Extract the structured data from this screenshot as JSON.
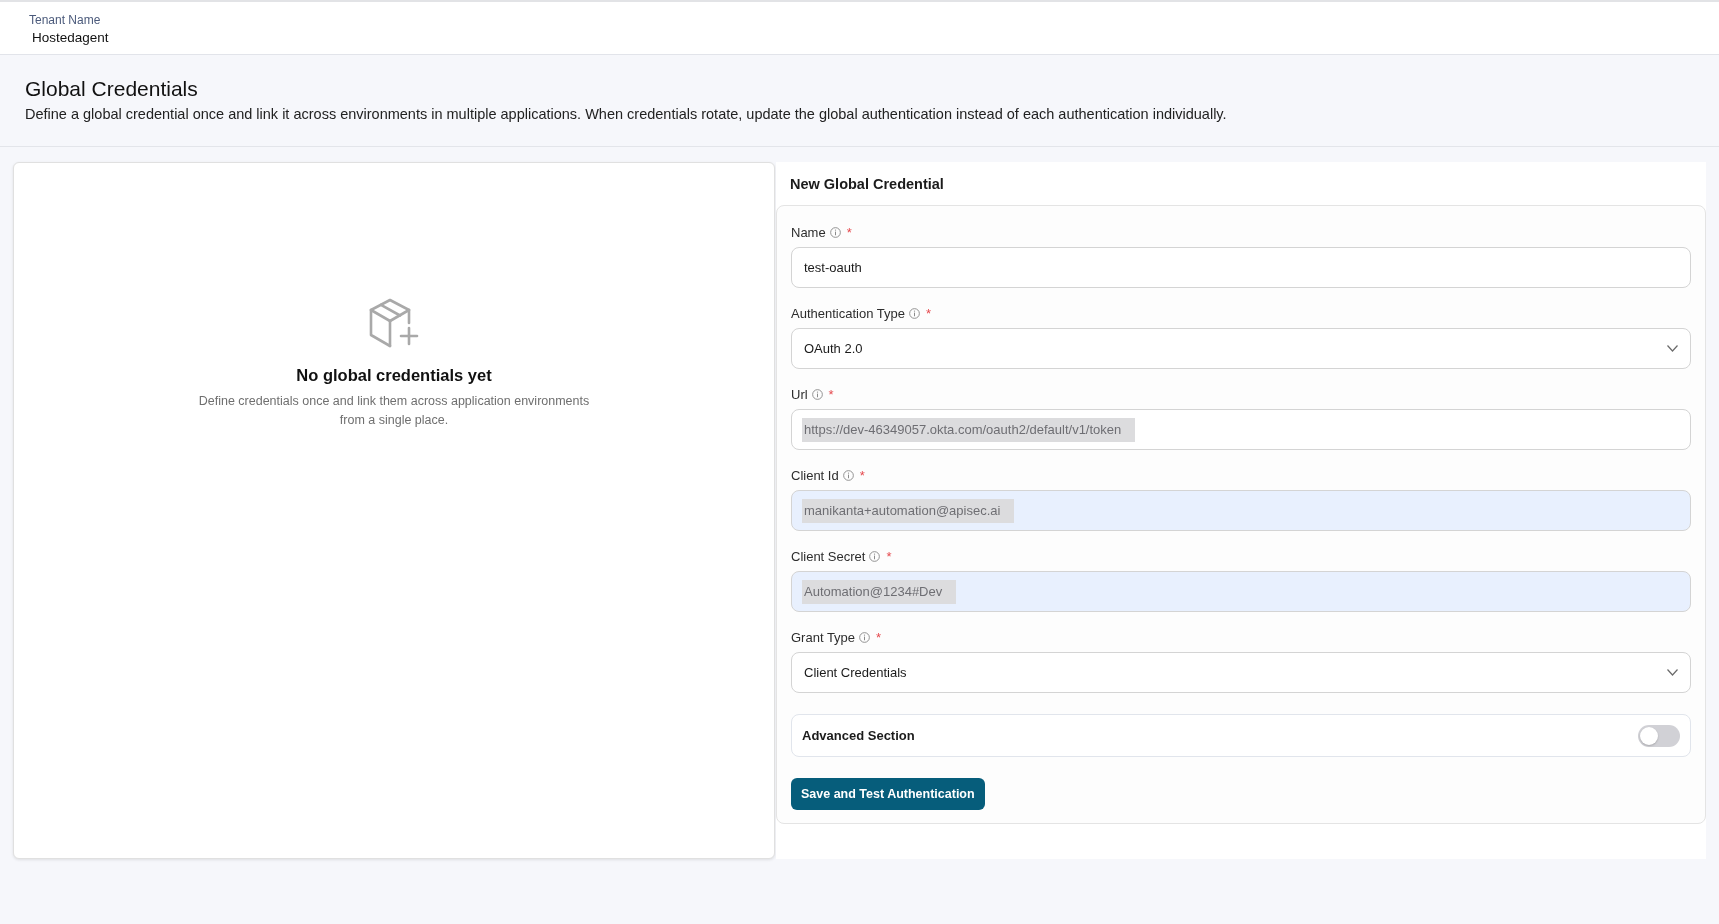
{
  "tenant": {
    "label": "Tenant Name",
    "value": "Hostedagent"
  },
  "page": {
    "title": "Global Credentials",
    "description": "Define a global credential once and link it across environments in multiple applications. When credentials rotate, update the global authentication instead of each authentication individually."
  },
  "empty_state": {
    "title": "No global credentials yet",
    "description": "Define credentials once and link them across application environments from a single place."
  },
  "form": {
    "title": "New Global Credential",
    "fields": [
      {
        "kind": "text",
        "label": "Name",
        "required_mark": "*",
        "value": "test-oauth",
        "redacted": false,
        "autofilled": false
      },
      {
        "kind": "select",
        "label": "Authentication Type",
        "required_mark": "*",
        "value": "OAuth 2.0"
      },
      {
        "kind": "text",
        "label": "Url",
        "required_mark": "*",
        "value": "https://dev-46349057.okta.com/oauth2/default/v1/token",
        "redacted": true,
        "autofilled": false
      },
      {
        "kind": "text",
        "label": "Client Id",
        "required_mark": "*",
        "value": "manikanta+automation@apisec.ai",
        "redacted": true,
        "autofilled": true
      },
      {
        "kind": "text",
        "label": "Client Secret",
        "required_mark": "*",
        "value": "Automation@1234#Dev",
        "redacted": true,
        "autofilled": true
      },
      {
        "kind": "select",
        "label": "Grant Type",
        "required_mark": "*",
        "value": "Client Credentials"
      }
    ],
    "advanced_section": {
      "label": "Advanced Section",
      "on": false
    },
    "submit_button": "Save and Test Authentication"
  }
}
